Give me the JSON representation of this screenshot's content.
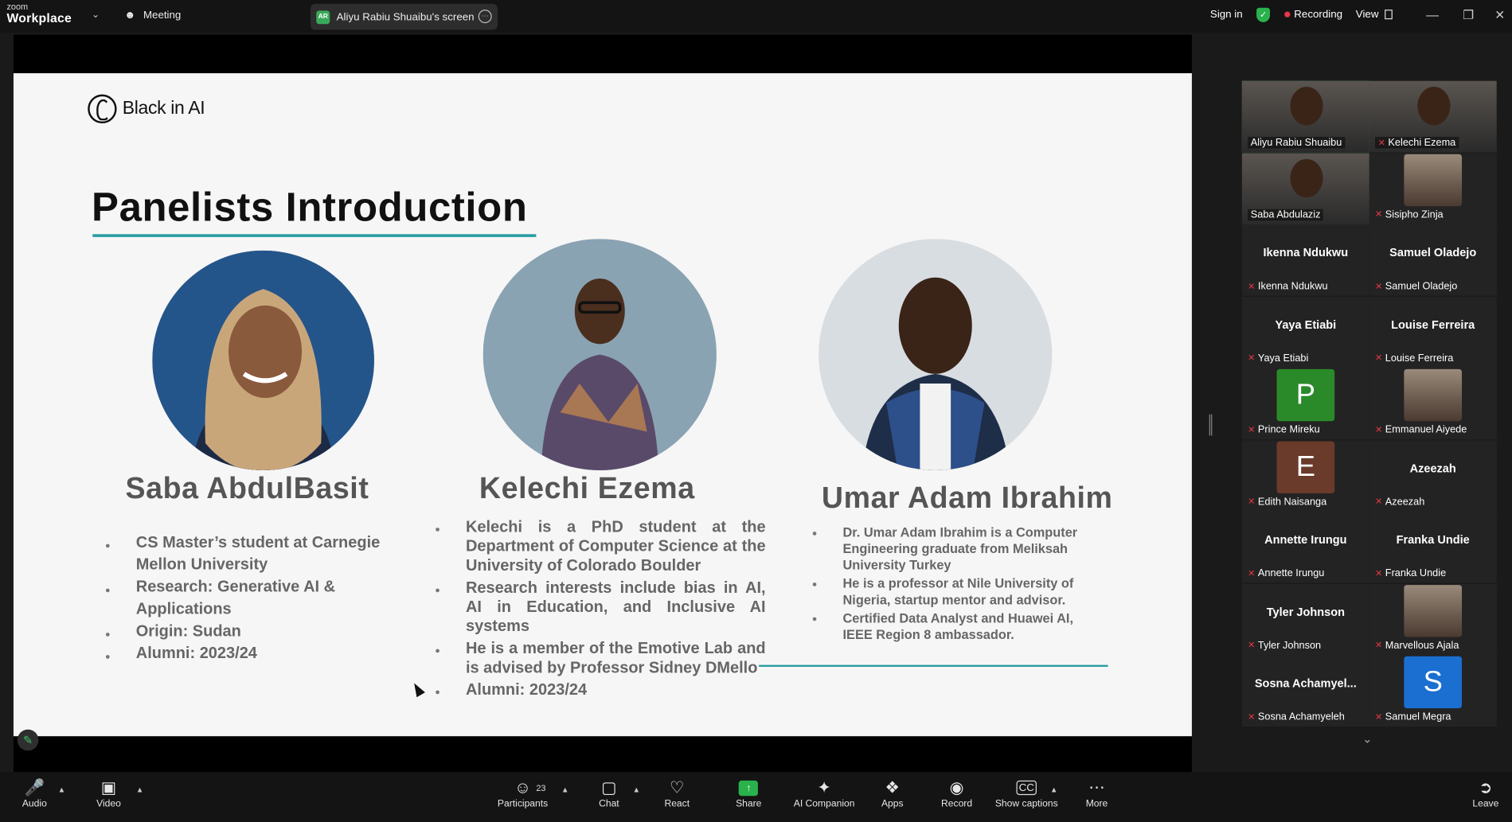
{
  "topbar": {
    "logo_line1": "zoom",
    "logo_line2": "Workplace",
    "meeting_label": "Meeting",
    "screen_badge": "AR",
    "screen_label": "Aliyu Rabiu Shuaibu's screen",
    "signin": "Sign in",
    "recording": "Recording",
    "view": "View",
    "colors": {
      "recording_dot": "#e8374a",
      "shield": "#2ab24c"
    }
  },
  "slide": {
    "brand": "Black in AI",
    "title": "Panelists Introduction",
    "accent_color": "#2a9ea3",
    "panelists": [
      {
        "name": "Saba  AbdulBasit",
        "bullets": [
          "CS Master’s student at Carnegie Mellon University",
          "Research: Generative AI & Applications",
          "Origin: Sudan",
          "Alumni: 2023/24"
        ]
      },
      {
        "name": "Kelechi Ezema",
        "bullets": [
          "Kelechi is a PhD student at the Department of Computer Science at the University of Colorado Boulder",
          "Research interests include bias in AI, AI in Education, and Inclusive AI systems",
          "He is a member of the Emotive Lab and is advised by Professor Sidney DMello",
          "Alumni: 2023/24"
        ]
      },
      {
        "name": "Umar Adam Ibrahim",
        "bullets": [
          "Dr. Umar Adam Ibrahim is a Computer Engineering graduate from Meliksah University Turkey",
          "He is a professor  at Nile University of Nigeria, startup mentor and advisor.",
          "Certified Data Analyst and Huawei AI, IEEE Region 8 ambassador."
        ]
      }
    ]
  },
  "gallery": {
    "tiles": [
      {
        "label": "Aliyu Rabiu Shuaibu",
        "big": "",
        "muted": false,
        "kind": "video",
        "active": true
      },
      {
        "label": "Kelechi Ezema",
        "big": "",
        "muted": true,
        "kind": "video"
      },
      {
        "label": "Saba Abdulaziz",
        "big": "",
        "muted": false,
        "kind": "video"
      },
      {
        "label": "Sisipho Zinja",
        "big": "",
        "muted": true,
        "kind": "photo"
      },
      {
        "label": "Ikenna Ndukwu",
        "big": "Ikenna Ndukwu",
        "muted": true,
        "kind": "name"
      },
      {
        "label": "Samuel Oladejo",
        "big": "Samuel Oladejo",
        "muted": true,
        "kind": "name"
      },
      {
        "label": "Yaya Etiabi",
        "big": "Yaya Etiabi",
        "muted": true,
        "kind": "name"
      },
      {
        "label": "Louise Ferreira",
        "big": "Louise Ferreira",
        "muted": true,
        "kind": "name"
      },
      {
        "label": "Prince Mireku",
        "big": "P",
        "muted": true,
        "kind": "letter",
        "color": "#2a8a2a"
      },
      {
        "label": "Emmanuel Aiyede",
        "big": "",
        "muted": true,
        "kind": "photo"
      },
      {
        "label": "Edith Naisanga",
        "big": "E",
        "muted": true,
        "kind": "letter",
        "color": "#6a3a2a"
      },
      {
        "label": "Azeezah",
        "big": "Azeezah",
        "muted": true,
        "kind": "name"
      },
      {
        "label": "Annette Irungu",
        "big": "Annette Irungu",
        "muted": true,
        "kind": "name"
      },
      {
        "label": "Franka Undie",
        "big": "Franka Undie",
        "muted": true,
        "kind": "name"
      },
      {
        "label": "Tyler Johnson",
        "big": "Tyler Johnson",
        "muted": true,
        "kind": "name"
      },
      {
        "label": "Marvellous Ajala",
        "big": "",
        "muted": true,
        "kind": "photo"
      },
      {
        "label": "Sosna Achamyeleh",
        "big": "Sosna  Achamyel...",
        "muted": true,
        "kind": "name"
      },
      {
        "label": "Samuel Megra",
        "big": "S",
        "muted": true,
        "kind": "letter",
        "color": "#1a6fd0"
      }
    ]
  },
  "toolbar": {
    "audio": "Audio",
    "video": "Video",
    "participants": "Participants",
    "participant_count": "23",
    "chat": "Chat",
    "react": "React",
    "share": "Share",
    "ai_companion": "AI Companion",
    "apps": "Apps",
    "record": "Record",
    "captions": "Show captions",
    "more": "More",
    "leave": "Leave"
  }
}
